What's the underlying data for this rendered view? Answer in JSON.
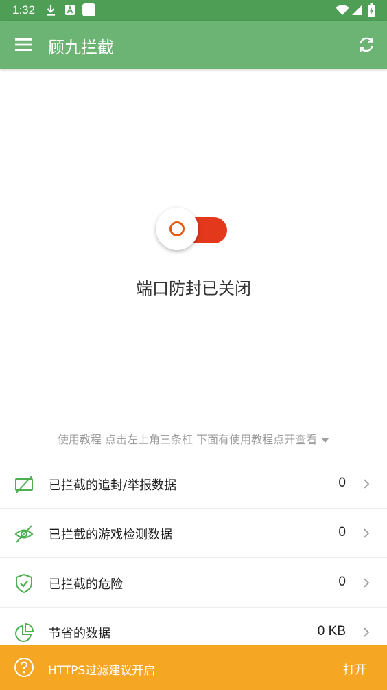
{
  "status_bar": {
    "time": "1:32",
    "icons": [
      "download-icon",
      "a-badge-icon",
      "square-app-icon",
      "wifi-icon",
      "signal-icon",
      "battery-charging-icon"
    ]
  },
  "app_bar": {
    "title": "顾九拦截",
    "menu_icon": "menu-icon",
    "refresh_icon": "refresh-icon",
    "background": "#6cb474"
  },
  "main": {
    "toggle": {
      "on": false,
      "track_color": "#e3381b",
      "ring_color": "#e35b12"
    },
    "status_text": "端口防封已关闭",
    "tutorial_text": "使用教程 点击左上角三条杠 下面有使用教程点开查看"
  },
  "stats": [
    {
      "label": "已拦截的追封/举报数据",
      "value": "0",
      "icon": "blocked-screen-icon"
    },
    {
      "label": "已拦截的游戏检测数据",
      "value": "0",
      "icon": "eye-off-icon"
    },
    {
      "label": "已拦截的危险",
      "value": "0",
      "icon": "shield-check-icon"
    },
    {
      "label": "节省的数据",
      "value": "0 KB",
      "icon": "pie-chart-icon"
    }
  ],
  "banner": {
    "text": "HTTPS过滤建议开启",
    "action": "打开",
    "icon": "help-circle-icon",
    "background": "#f5a623"
  },
  "colors": {
    "accent_green": "#4caf50",
    "status_bar": "#4e9e56"
  }
}
